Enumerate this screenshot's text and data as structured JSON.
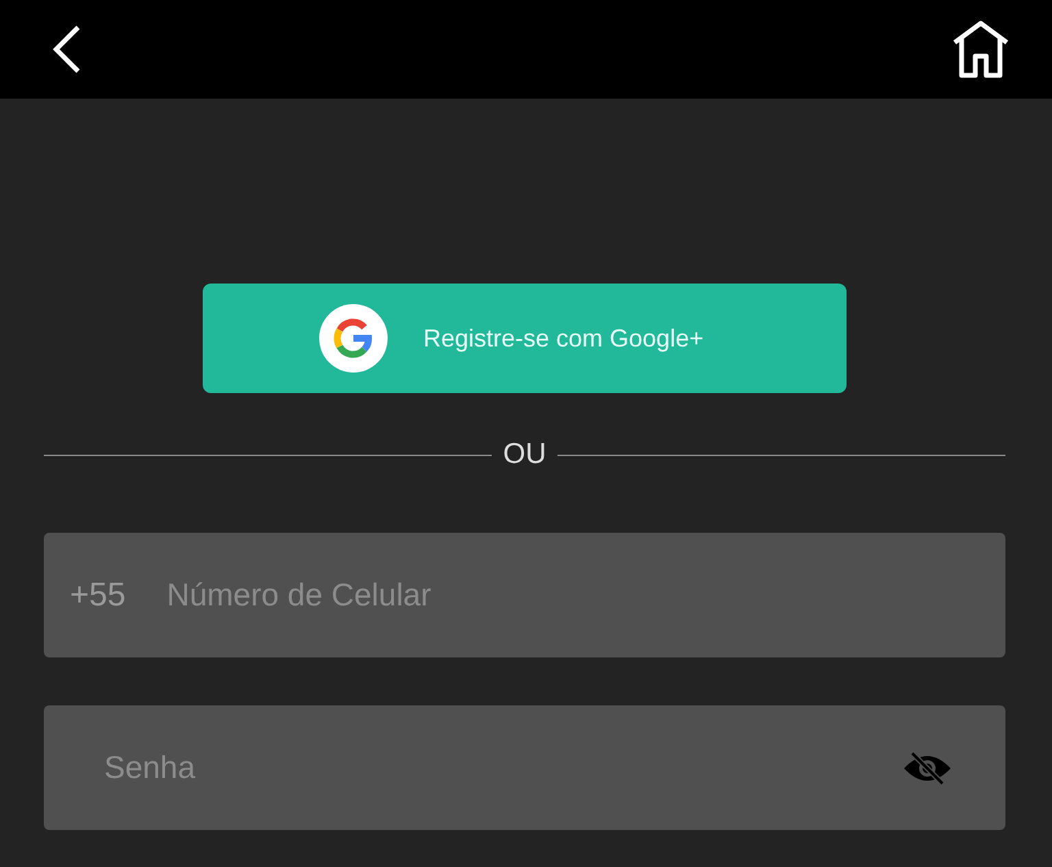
{
  "google_button": {
    "label": "Registre-se com Google+"
  },
  "divider": {
    "label": "OU"
  },
  "phone_field": {
    "prefix": "+55",
    "placeholder": "Número de Celular"
  },
  "password_field": {
    "placeholder": "Senha"
  }
}
